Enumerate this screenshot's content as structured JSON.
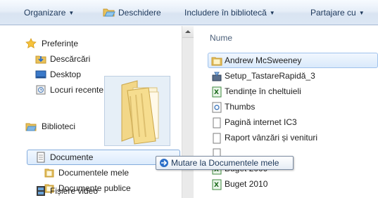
{
  "toolbar": {
    "organize_label": "Organizare",
    "open_label": "Deschidere",
    "include_label": "Includere în bibliotecă",
    "share_label": "Partajare cu"
  },
  "nav": {
    "favorites_label": "Preferințe",
    "downloads_label": "Descărcări",
    "desktop_label": "Desktop",
    "recent_label": "Locuri recente",
    "libraries_label": "Biblioteci",
    "documents_label": "Documente",
    "my_documents_label": "Documentele mele",
    "public_documents_label": "Documente publice",
    "videos_label": "Fișiere video"
  },
  "list": {
    "column_name": "Nume",
    "files": [
      {
        "name": "Andrew McSweeney",
        "icon": "folder-icon"
      },
      {
        "name": "Setup_TastareRapidă_3",
        "icon": "setup-icon"
      },
      {
        "name": "Tendințe în cheltuieli",
        "icon": "excel-icon"
      },
      {
        "name": "Thumbs",
        "icon": "system-file-icon"
      },
      {
        "name": "Pagină internet IC3",
        "icon": "document-icon"
      },
      {
        "name": "Raport vânzări și venituri",
        "icon": "document-icon"
      },
      {
        "name": "",
        "icon": "document-icon"
      },
      {
        "name": "Buget 2009",
        "icon": "excel-icon"
      },
      {
        "name": "Buget 2010",
        "icon": "excel-icon"
      }
    ]
  },
  "drag_tooltip": {
    "text": "Mutare la Documentele mele"
  },
  "colors": {
    "selection_border": "#84acdd",
    "toolbar_text": "#1e395b",
    "folder_yellow": "#e9c15a"
  }
}
